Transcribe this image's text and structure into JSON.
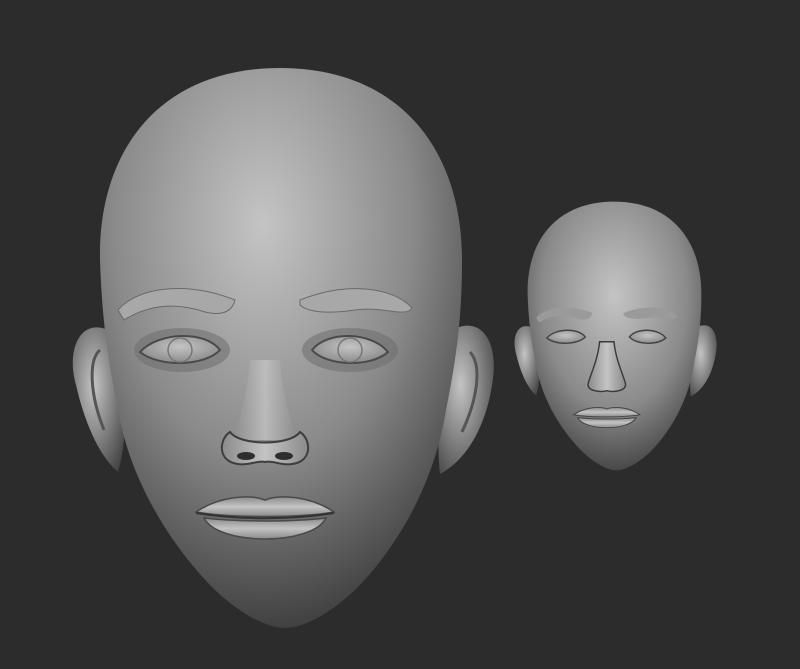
{
  "scene": {
    "background_color": "#2c2c2c",
    "clay_light": "#c4c4c4",
    "clay_mid": "#8a8a8a",
    "clay_dark": "#3a3a3a",
    "objects": [
      {
        "name": "large-head-sculpt",
        "kind": "head-model"
      },
      {
        "name": "small-head-sculpt",
        "kind": "head-model"
      }
    ]
  }
}
